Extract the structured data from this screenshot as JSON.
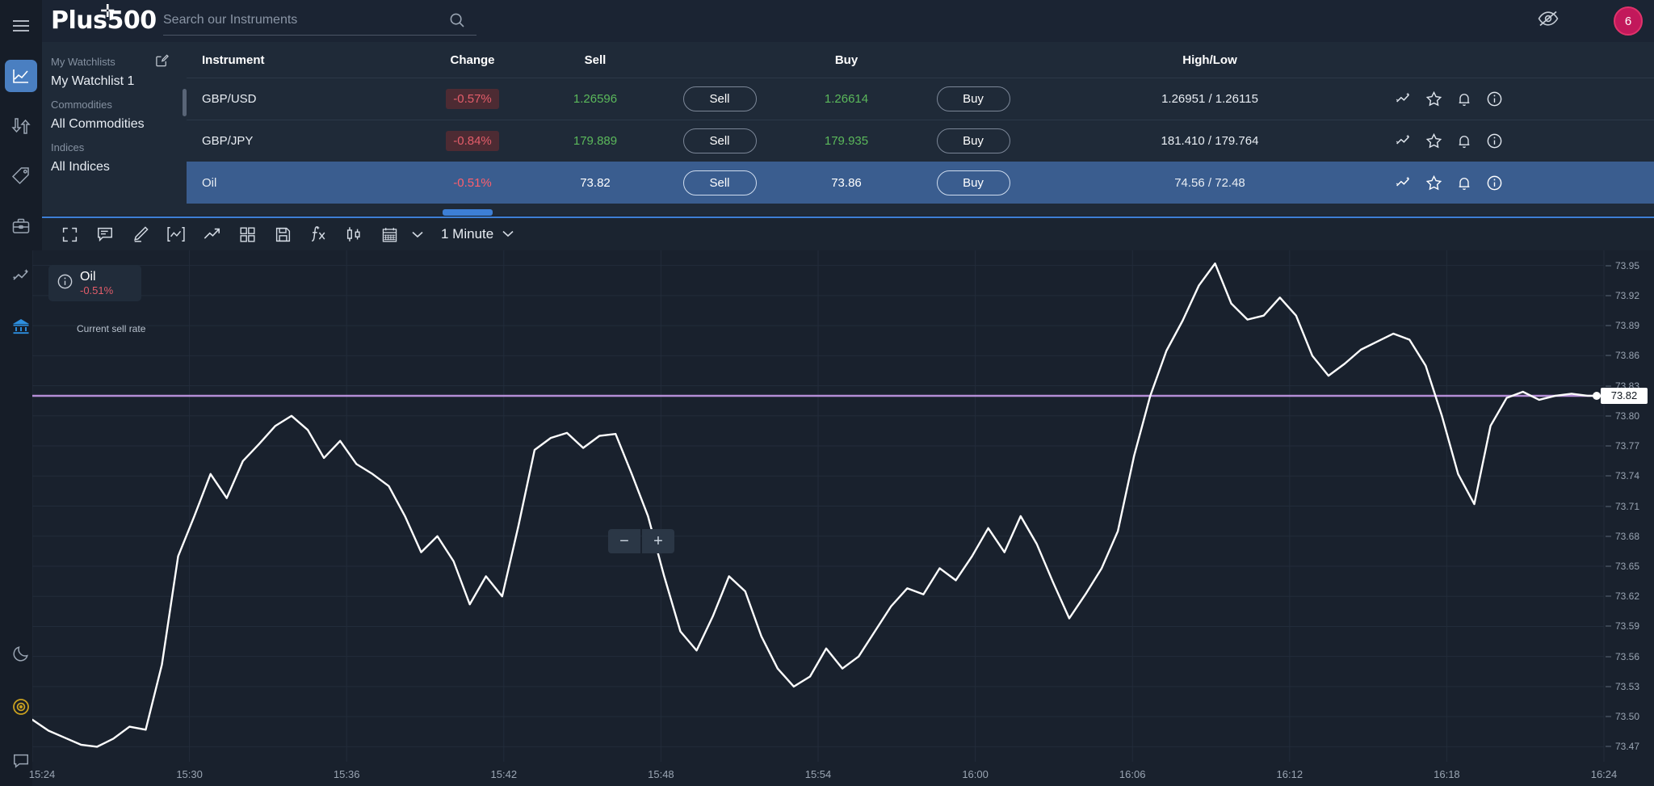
{
  "topbar": {
    "logo_text": "Plus500",
    "search_placeholder": "Search our Instruments",
    "search_value": "",
    "notification_count": "6"
  },
  "watchlist_panel": {
    "groups": [
      {
        "label": "My Watchlists",
        "item": "My Watchlist 1"
      },
      {
        "label": "Commodities",
        "item": "All Commodities"
      },
      {
        "label": "Indices",
        "item": "All Indices"
      }
    ]
  },
  "table": {
    "headers": {
      "instrument": "Instrument",
      "change": "Change",
      "sell": "Sell",
      "buy": "Buy",
      "highlow": "High/Low"
    },
    "sell_button_label": "Sell",
    "buy_button_label": "Buy",
    "rows": [
      {
        "instrument": "GBP/USD",
        "change": "-0.57%",
        "sell": "1.26596",
        "buy": "1.26614",
        "highlow": "1.26951 / 1.26115",
        "selected": false
      },
      {
        "instrument": "GBP/JPY",
        "change": "-0.84%",
        "sell": "179.889",
        "buy": "179.935",
        "highlow": "181.410 / 179.764",
        "selected": false
      },
      {
        "instrument": "Oil",
        "change": "-0.51%",
        "sell": "73.82",
        "buy": "73.86",
        "highlow": "74.56 / 72.48",
        "selected": true
      }
    ]
  },
  "toolbar": {
    "timeframe_label": "1 Minute",
    "icons": [
      "fullscreen-icon",
      "comment-icon",
      "pencil-icon",
      "indicator-icon",
      "trend-icon",
      "grid-icon",
      "save-icon",
      "function-icon",
      "candlestick-icon",
      "calendar-icon"
    ]
  },
  "chart_panel": {
    "badge_instrument": "Oil",
    "badge_change": "-0.51%",
    "current_rate_label": "Current sell rate",
    "current_rate_value": "73.82",
    "zoom_out_label": "−",
    "zoom_in_label": "+"
  },
  "colors": {
    "accent_blue": "#3d7fd6",
    "selected_row": "#3a5d8f",
    "price_up": "#5bb85b",
    "price_down": "#e35d6a",
    "sell_line": "#b48ed6",
    "series_line": "#ffffff",
    "avatar": "#c2185b"
  },
  "chart_data": {
    "type": "line",
    "title": "Oil",
    "xlabel": "",
    "ylabel": "",
    "grid": true,
    "legend": "none",
    "ylim": [
      73.455,
      73.965
    ],
    "y_ticks": [
      73.95,
      73.92,
      73.89,
      73.86,
      73.83,
      73.8,
      73.77,
      73.74,
      73.71,
      73.68,
      73.65,
      73.62,
      73.59,
      73.56,
      73.53,
      73.5,
      73.47
    ],
    "x_ticks": [
      "15:24",
      "15:30",
      "15:36",
      "15:42",
      "15:48",
      "15:54",
      "16:00",
      "16:06",
      "16:12",
      "16:18",
      "16:24"
    ],
    "annotations": [
      {
        "type": "hline",
        "label": "Current sell rate",
        "value": 73.82,
        "color": "#b48ed6"
      }
    ],
    "series": [
      {
        "name": "Oil",
        "color": "#ffffff",
        "values": [
          73.497,
          73.486,
          73.479,
          73.472,
          73.47,
          73.478,
          73.49,
          73.487,
          73.552,
          73.66,
          73.7,
          73.742,
          73.718,
          73.755,
          73.772,
          73.79,
          73.8,
          73.786,
          73.758,
          73.775,
          73.752,
          73.742,
          73.73,
          73.7,
          73.664,
          73.68,
          73.655,
          73.612,
          73.64,
          73.62,
          73.69,
          73.766,
          73.778,
          73.783,
          73.768,
          73.78,
          73.782,
          73.742,
          73.7,
          73.64,
          73.585,
          73.566,
          73.6,
          73.64,
          73.625,
          73.58,
          73.548,
          73.53,
          73.54,
          73.568,
          73.548,
          73.56,
          73.585,
          73.61,
          73.628,
          73.622,
          73.648,
          73.636,
          73.66,
          73.688,
          73.664,
          73.7,
          73.672,
          73.634,
          73.598,
          73.622,
          73.648,
          73.685,
          73.76,
          73.82,
          73.865,
          73.895,
          73.93,
          73.952,
          73.912,
          73.896,
          73.9,
          73.918,
          73.9,
          73.86,
          73.84,
          73.852,
          73.866,
          73.874,
          73.882,
          73.876,
          73.85,
          73.8,
          73.742,
          73.712,
          73.79,
          73.818,
          73.824,
          73.816,
          73.82,
          73.822,
          73.82,
          73.82
        ]
      }
    ]
  }
}
